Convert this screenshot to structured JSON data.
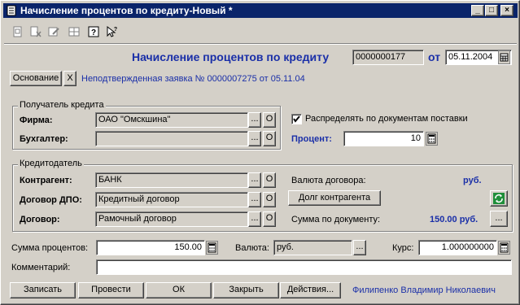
{
  "window": {
    "title": "Начисление процентов по кредиту-Новый *",
    "controls": {
      "minimize": "_",
      "maximize": "□",
      "close": "×"
    }
  },
  "toolbar": {
    "icons": [
      "document-icon",
      "cut-icon",
      "edit-icon",
      "grid-icon",
      "help-icon",
      "pointer-help-icon"
    ]
  },
  "header": {
    "doc_title": "Начисление процентов по кредиту",
    "number": "0000000177",
    "date_label": "от",
    "date": "05.11.2004"
  },
  "basis": {
    "button_label": "Основание",
    "clear_label": "X",
    "text": "Неподтвержденная заявка № 0000007275 от 05.11.04"
  },
  "recipient": {
    "group_title": "Получатель кредита",
    "firm_label": "Фирма:",
    "firm_value": "ОАО \"Омскшина\"",
    "accountant_label": "Бухгалтер:",
    "accountant_value": ""
  },
  "distribution": {
    "checkbox_label": "Распределять по документам поставки",
    "checked": true,
    "percent_label": "Процент:",
    "percent_value": "10"
  },
  "creditor": {
    "group_title": "Кредитодатель",
    "contractor_label": "Контрагент:",
    "contractor_value": "БАНК",
    "dpo_label": "Договор ДПО:",
    "dpo_value": "Кредитный договор",
    "contract_label": "Договор:",
    "contract_value": "Рамочный договор",
    "currency_label": "Валюта договора:",
    "currency_value": "руб.",
    "debt_button": "Долг контрагента",
    "sum_label": "Сумма по документу:",
    "sum_value": "150.00 руб."
  },
  "bottom": {
    "interest_label": "Сумма процентов:",
    "interest_value": "150.00",
    "currency_label": "Валюта:",
    "currency_value": "руб.",
    "rate_label": "Курс:",
    "rate_value": "1.000000000",
    "comment_label": "Комментарий:",
    "comment_value": ""
  },
  "actions": {
    "save": "Записать",
    "post": "Провести",
    "ok": "ОК",
    "close": "Закрыть",
    "actions": "Действия...",
    "author": "Филипенко Владимир Николаевич"
  },
  "small_buttons": {
    "select": "...",
    "clear": "О"
  }
}
